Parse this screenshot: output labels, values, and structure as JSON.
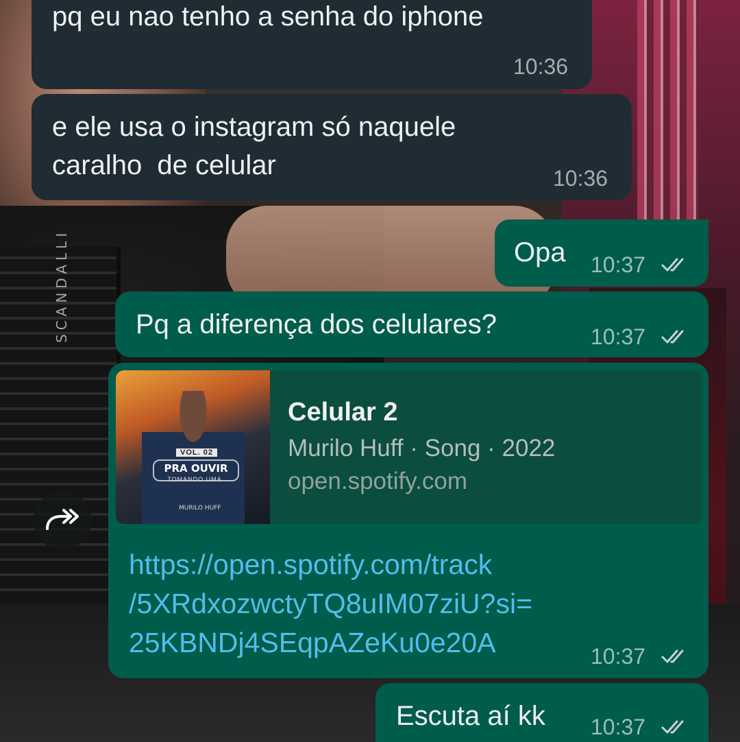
{
  "chat": {
    "messages": [
      {
        "direction": "incoming",
        "text": "pq eu nao tenho a senha do iphone",
        "time": "10:36"
      },
      {
        "direction": "incoming",
        "line1": "e ele usa o instagram só naquele",
        "line2": "caralho  de celular",
        "time": "10:36"
      },
      {
        "direction": "outgoing",
        "text": "Opa",
        "time": "10:37",
        "status": "read"
      },
      {
        "direction": "outgoing",
        "text": "Pq a diferença dos celulares?",
        "time": "10:37",
        "status": "read"
      },
      {
        "direction": "outgoing",
        "preview": {
          "title": "Celular 2",
          "description": "Murilo Huff · Song · 2022",
          "domain": "open.spotify.com",
          "art": {
            "vol": "VOL. 02",
            "title": "PRA OUVIR",
            "subtitle": "TOMANDO UMA",
            "signature": "MURILO HUFF"
          }
        },
        "link_line1": "https://open.spotify.com/track",
        "link_line2": "/5XRdxozwctyTQ8uIM07ziU?si=",
        "link_line3": "25KBNDj4SEqpAZeKu0e20A",
        "time": "10:37",
        "status": "read"
      },
      {
        "direction": "outgoing",
        "text": "Escuta aí kk",
        "time": "10:37",
        "status": "read"
      }
    ],
    "forward_icon": "forward-icon"
  },
  "wallpaper": {
    "accordion_brand": "SCANDALLI"
  },
  "colors": {
    "incoming_bubble": "#202c33",
    "outgoing_bubble": "#005c4b",
    "link": "#53bdeb",
    "ticks": "#c9d3d0"
  }
}
